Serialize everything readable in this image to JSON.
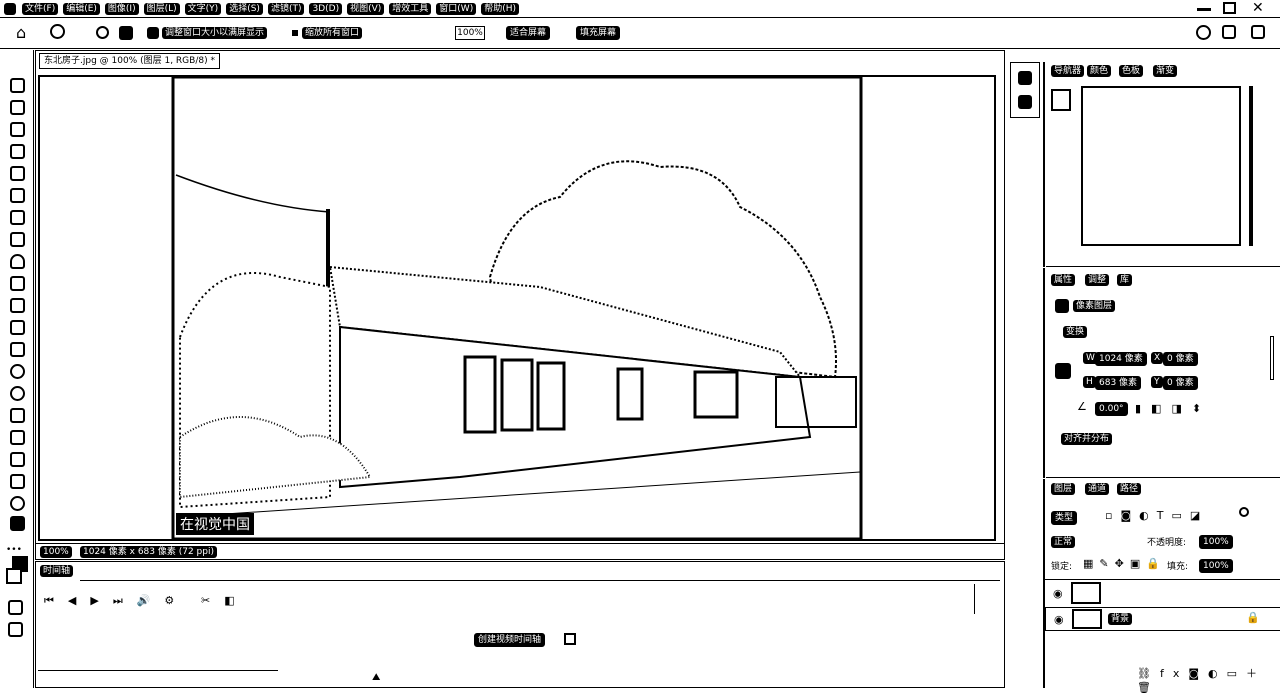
{
  "menu": {
    "app_icon": "ps-logo-icon",
    "items": [
      "文件(F)",
      "编辑(E)",
      "图像(I)",
      "图层(L)",
      "文字(Y)",
      "选择(S)",
      "滤镜(T)",
      "3D(D)",
      "视图(V)",
      "增效工具",
      "窗口(W)",
      "帮助(H)"
    ]
  },
  "options": {
    "checkbox_resize": "调整窗口大小以满屏显示",
    "checkbox_zoom_all": "缩放所有窗口",
    "zoom_value": "100%",
    "btn_fit": "适合屏幕",
    "btn_fill": "填充屏幕"
  },
  "document": {
    "tab_title": "东北房子.jpg @ 100% (图层 1, RGB/8) *",
    "watermark": "在视觉中国",
    "status_zoom": "100%",
    "status_size": "1024 像素 x 683 像素 (72 ppi)"
  },
  "timeline": {
    "tab": "时间轴",
    "create_button": "创建视频时间轴"
  },
  "navigator": {
    "tabs": [
      "导航器",
      "颜色",
      "色板",
      "渐变"
    ]
  },
  "properties": {
    "tabs": [
      "属性",
      "调整",
      "库"
    ],
    "layer_type": "像素图层",
    "section_transform": "变换",
    "w_label": "W",
    "w_value": "1024 像素",
    "x_label": "X",
    "x_value": "0 像素",
    "h_label": "H",
    "h_value": "683 像素",
    "y_label": "Y",
    "y_value": "0 像素",
    "angle_value": "0.00°",
    "section_align": "对齐并分布"
  },
  "layers": {
    "tabs": [
      "图层",
      "通道",
      "路径"
    ],
    "filter_kind": "类型",
    "blend_mode": "正常",
    "opacity_label": "不透明度:",
    "opacity_value": "100%",
    "lock_label": "锁定:",
    "fill_label": "填充:",
    "fill_value": "100%",
    "layer1_name": "",
    "layer2_name": "背景"
  },
  "colors": {
    "fg": "#000000",
    "bg": "#ffffff"
  }
}
